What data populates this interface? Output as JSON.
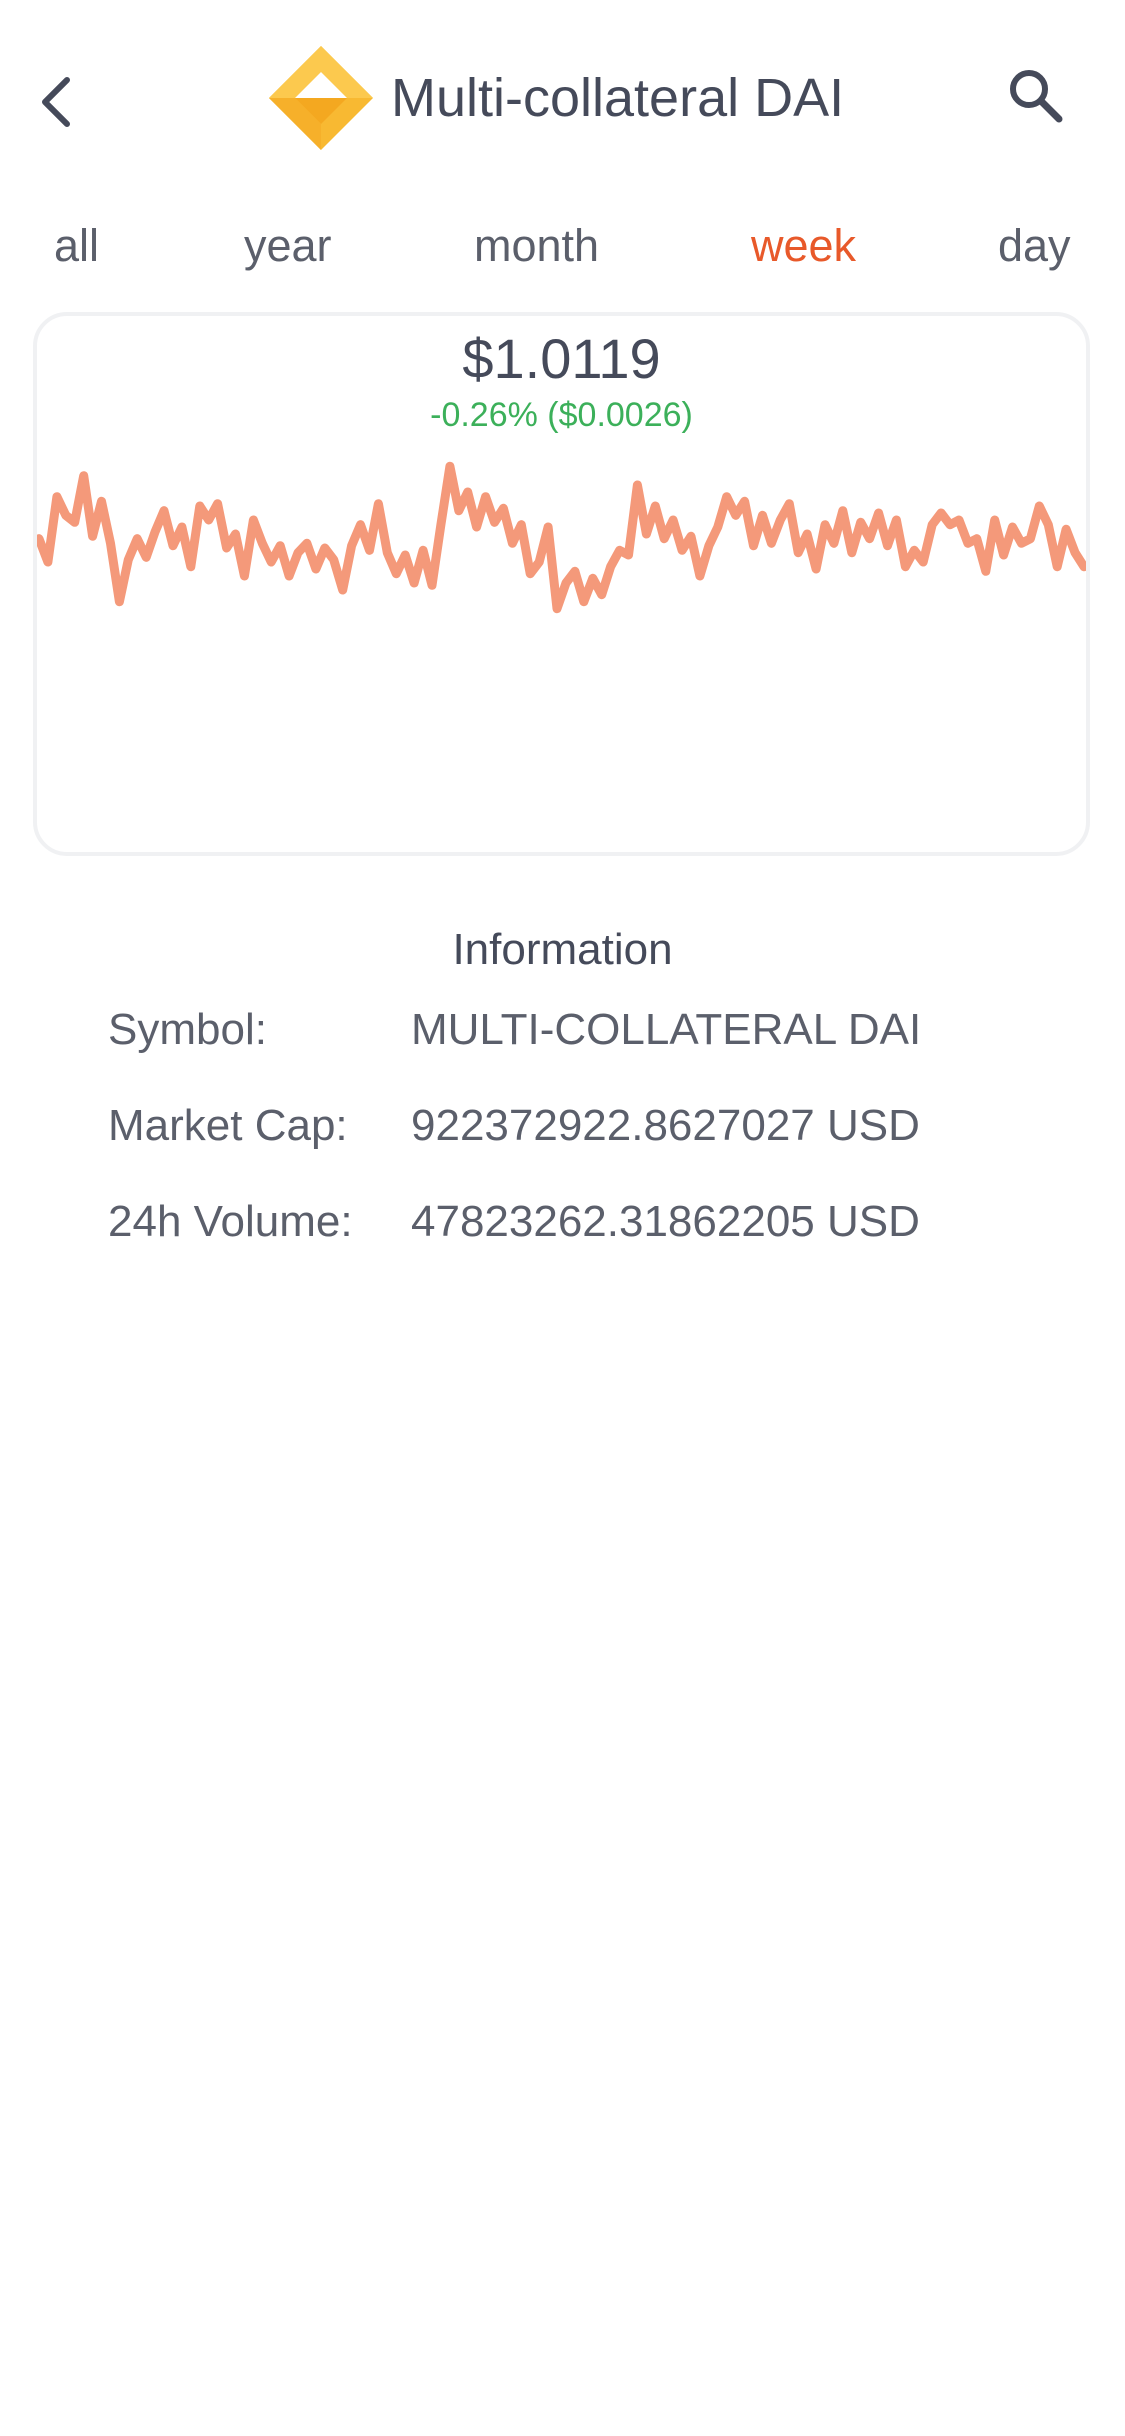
{
  "header": {
    "title": "Multi-collateral DAI",
    "back_icon": "chevron-left-icon",
    "search_icon": "search-icon",
    "logo_icon": "dai-logo-icon"
  },
  "tabs": [
    {
      "label": "all",
      "active": false
    },
    {
      "label": "year",
      "active": false
    },
    {
      "label": "month",
      "active": false
    },
    {
      "label": "week",
      "active": true
    },
    {
      "label": "day",
      "active": false
    }
  ],
  "price_card": {
    "price": "$1.0119",
    "change": "-0.26% ($0.0026)"
  },
  "chart_data": {
    "type": "line",
    "series": [
      {
        "values": [
          1.0131,
          1.0121,
          1.0149,
          1.0141,
          1.0138,
          1.0158,
          1.0132,
          1.0147,
          1.0129,
          1.0104,
          1.0122,
          1.0131,
          1.0123,
          1.0134,
          1.0143,
          1.0128,
          1.0136,
          1.0119,
          1.0145,
          1.0139,
          1.0146,
          1.0127,
          1.0133,
          1.0115,
          1.0139,
          1.0129,
          1.0121,
          1.0128,
          1.0115,
          1.0125,
          1.0129,
          1.0118,
          1.0127,
          1.0122,
          1.0109,
          1.0128,
          1.0137,
          1.0126,
          1.0146,
          1.0125,
          1.0116,
          1.0124,
          1.0112,
          1.0126,
          1.0111,
          1.0137,
          1.0162,
          1.0143,
          1.0151,
          1.0136,
          1.0149,
          1.0138,
          1.0144,
          1.0129,
          1.0137,
          1.0116,
          1.0121,
          1.0136,
          1.0101,
          1.0112,
          1.0117,
          1.0104,
          1.0114,
          1.0107,
          1.0119,
          1.0126,
          1.0124,
          1.0154,
          1.0133,
          1.0145,
          1.0131,
          1.0139,
          1.0126,
          1.0132,
          1.0115,
          1.0128,
          1.0136,
          1.0149,
          1.0141,
          1.0147,
          1.0128,
          1.0141,
          1.0129,
          1.0139,
          1.0146,
          1.0125,
          1.0133,
          1.0118,
          1.0137,
          1.0129,
          1.0143,
          1.0125,
          1.0138,
          1.0131,
          1.0142,
          1.0128,
          1.0139,
          1.0119,
          1.0126,
          1.0121,
          1.0137,
          1.0142,
          1.0137,
          1.0139,
          1.0129,
          1.0131,
          1.0117,
          1.0139,
          1.0124,
          1.0136,
          1.0129,
          1.0131,
          1.0145,
          1.0137,
          1.0119,
          1.0135,
          1.0125,
          1.0119
        ]
      }
    ],
    "ylim": [
      1.0085,
      1.0175
    ],
    "color": "#f4997a",
    "grid": false
  },
  "information": {
    "title": "Information",
    "rows": [
      {
        "label": "Symbol:",
        "value": "MULTI-COLLATERAL DAI"
      },
      {
        "label": "Market Cap:",
        "value": "922372922.8627027 USD"
      },
      {
        "label": "24h Volume:",
        "value": "47823262.31862205 USD"
      }
    ]
  },
  "colors": {
    "accent": "#e8592a",
    "positive_change": "#3cb05a",
    "text": "#454a5a",
    "logo_gold": "#f8b932"
  }
}
